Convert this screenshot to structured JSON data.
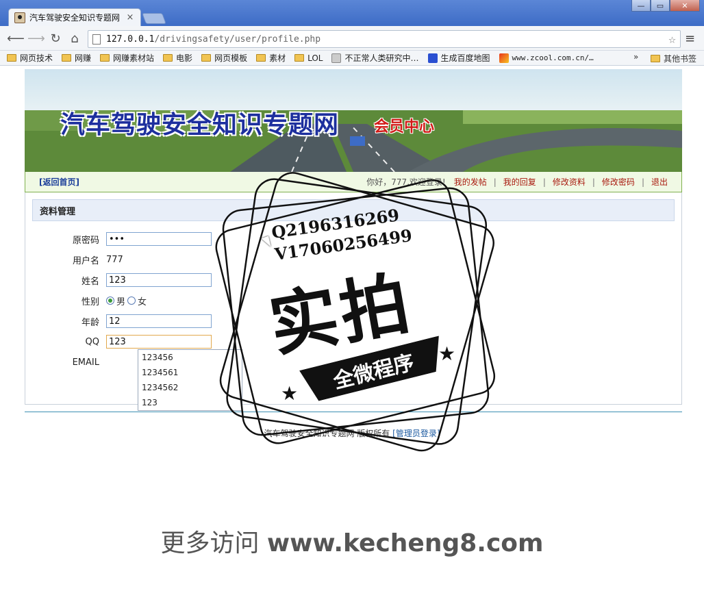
{
  "browser": {
    "tab_title": "汽车驾驶安全知识专题网",
    "tab_close": "×",
    "url_host": "127.0.0.1",
    "url_path": "/drivingsafety/user/profile.php",
    "window_buttons": [
      "—",
      "▭",
      "✕"
    ],
    "bookmarks": [
      {
        "label": "网页技术",
        "icon": "folder-icon"
      },
      {
        "label": "网赚",
        "icon": "folder-icon"
      },
      {
        "label": "网赚素材站",
        "icon": "folder-icon"
      },
      {
        "label": "电影",
        "icon": "folder-icon"
      },
      {
        "label": "网页模板",
        "icon": "folder-icon"
      },
      {
        "label": "素材",
        "icon": "folder-icon"
      },
      {
        "label": "LOL",
        "icon": "folder-icon"
      },
      {
        "label": "不正常人类研究中…",
        "icon": "site-icon"
      },
      {
        "label": "生成百度地图",
        "icon": "baidu-paw-icon"
      },
      {
        "label": "www.zcool.com.cn/…",
        "icon": "zcool-icon"
      }
    ],
    "bookmarks_more": "»",
    "other_bookmarks": "其他书签"
  },
  "site": {
    "title": "汽车驾驶安全知识专题网",
    "subtitle": "会员中心"
  },
  "nav": {
    "home": "[返回首页]",
    "greeting": "你好，777,欢迎登录!",
    "links": [
      "我的发帖",
      "我的回复",
      "修改资料",
      "修改密码",
      "退出"
    ],
    "separator": "|"
  },
  "section": {
    "title": "资料管理"
  },
  "form": {
    "old_password_label": "原密码",
    "old_password_value": "•••",
    "username_label": "用户名",
    "username_value": "777",
    "name_label": "姓名",
    "name_value": "123",
    "gender_label": "性别",
    "gender_male": "男",
    "gender_female": "女",
    "age_label": "年龄",
    "age_value": "12",
    "qq_label": "QQ",
    "qq_value": "123",
    "email_label": "EMAIL",
    "autocomplete": [
      "123456",
      "1234561",
      "1234562",
      "123"
    ]
  },
  "footer": {
    "text": "汽车驾驶安全知识专题网  版权所有",
    "admin_link": "[管理员登录]"
  },
  "watermark": {
    "qq": "Q2196316269",
    "v": "V17060256499",
    "main": "实拍",
    "ribbon": "全微程序",
    "bottom_cn": "更多访问 ",
    "bottom_url": "www.kecheng8.com"
  }
}
